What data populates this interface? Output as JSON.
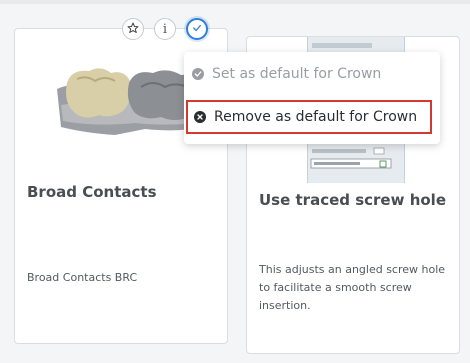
{
  "colors": {
    "accent": "#2f7fd8",
    "highlight_border": "#d23a2f",
    "disabled_text": "#9a9da2",
    "text": "#2b2d31"
  },
  "toolbar": {
    "favorite_icon": "star-icon",
    "info_label": "i",
    "check_icon": "check-icon"
  },
  "menu": {
    "items": [
      {
        "label": "Set as default for Crown",
        "icon": "check-circle-icon",
        "enabled": false
      },
      {
        "label": "Remove as default for Crown",
        "icon": "x-circle-icon",
        "enabled": true,
        "highlighted": true
      }
    ]
  },
  "cards": [
    {
      "title": "Broad Contacts",
      "subtitle": "Broad Contacts BRC"
    },
    {
      "title": "Use traced screw hole",
      "description": "This adjusts an angled screw hole to facilitate a smooth screw insertion."
    }
  ]
}
